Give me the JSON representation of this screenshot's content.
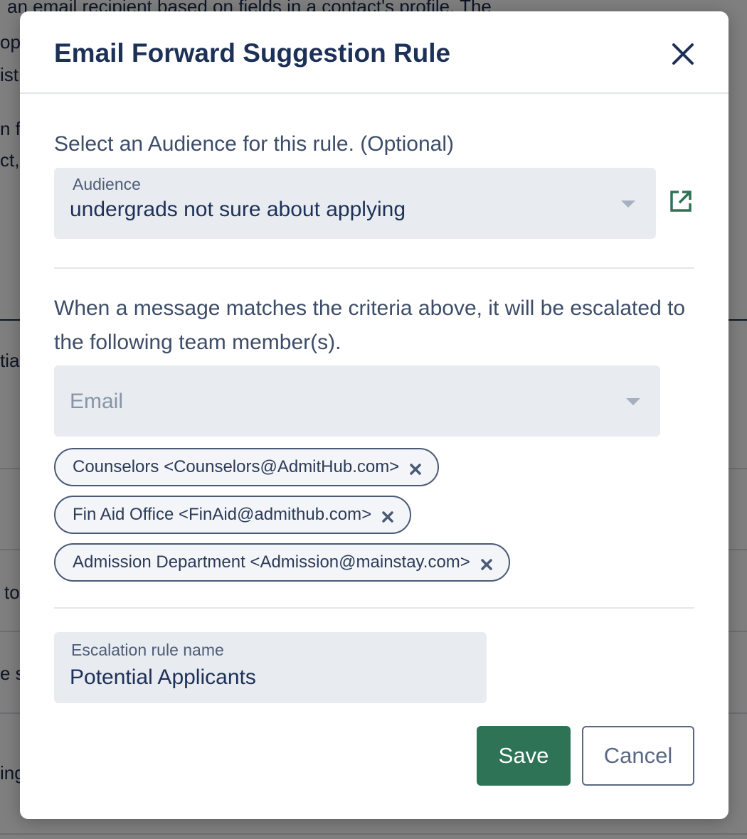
{
  "modal": {
    "title": "Email Forward Suggestion Rule",
    "audience_prompt": "Select an Audience for this rule. (Optional)",
    "audience": {
      "label": "Audience",
      "value": "undergrads not sure about applying"
    },
    "escalation_description": "When a message matches the criteria above, it will be escalated to the following team member(s).",
    "email_select": {
      "placeholder": "Email"
    },
    "recipients": [
      "Counselors <Counselors@AdmitHub.com>",
      "Fin Aid Office <FinAid@admithub.com>",
      "Admission Department <Admission@mainstay.com>"
    ],
    "rule_name": {
      "label": "Escalation rule name",
      "value": "Potential Applicants"
    },
    "buttons": {
      "save": "Save",
      "cancel": "Cancel"
    }
  },
  "background": {
    "fragments": [
      "an email recipient based on fields in a contact's profile. The",
      "op",
      "ist",
      "n f",
      "ct,",
      "tia",
      "to",
      "e s",
      "ing"
    ]
  },
  "colors": {
    "primary": "#2e7356",
    "title": "#1d3158",
    "field_bg": "#e8ebf0",
    "chip_border": "#4a5a74"
  },
  "icons": {
    "close": "close-icon",
    "external_link": "external-link-icon",
    "chip_remove": "x-icon",
    "dropdown": "chevron-down-icon"
  }
}
